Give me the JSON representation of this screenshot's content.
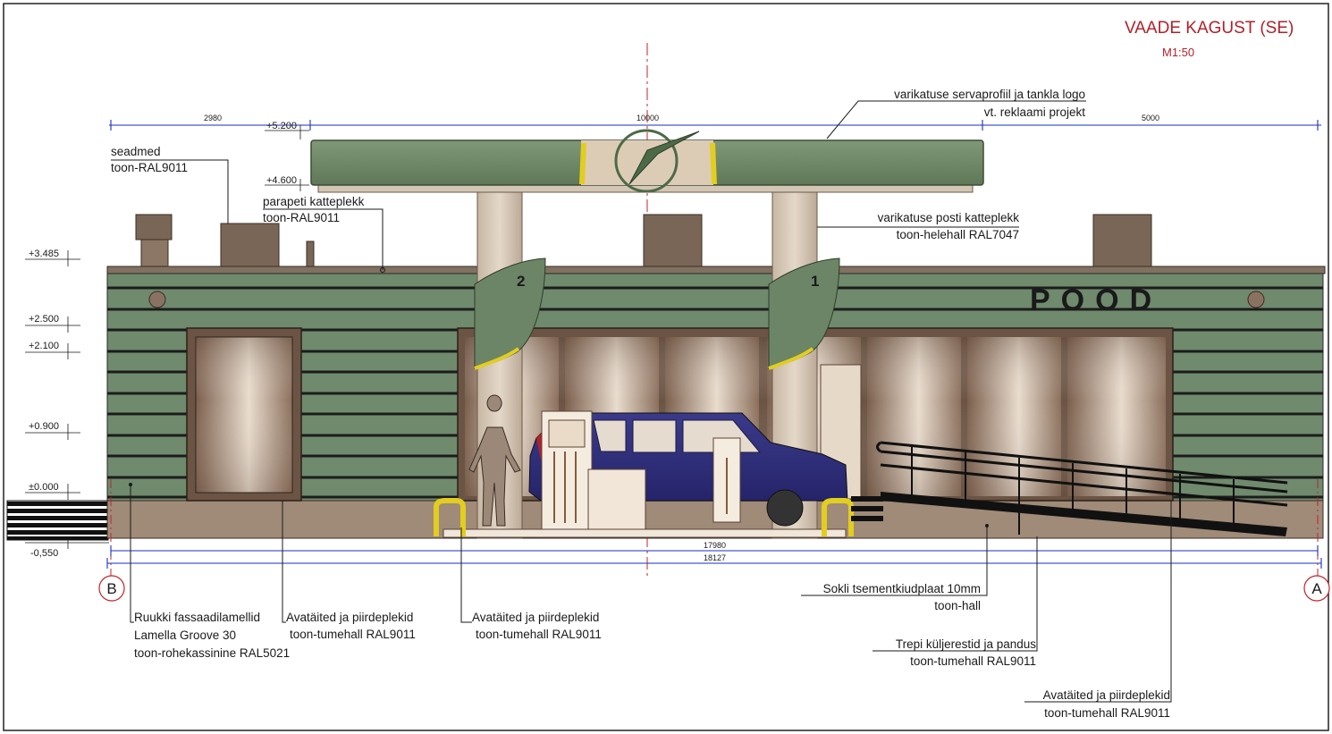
{
  "title": "VAADE KAGUST (SE)",
  "scale": "M1:50",
  "colors": {
    "facade": "#6f8a6d",
    "canopy": "#6e8766",
    "column": "#cfc1b0",
    "accent": "#e3cd1f",
    "axis": "#c0242b",
    "dimension": "#1a2ec0"
  },
  "levels": {
    "l1": "+3.485",
    "l2": "+2.500",
    "l3": "+2.100",
    "l4": "+0.900",
    "l5": "±0.000",
    "l6": "-0,550",
    "canopy_top": "+5.200",
    "canopy_bottom": "+4.600"
  },
  "dimensions": {
    "d_left": "2980",
    "d_mid": "10000",
    "d_right": "5000",
    "d_inner": "17980",
    "d_overall": "18127"
  },
  "axes": {
    "left": "B",
    "right": "A"
  },
  "sign_text": "POOD",
  "pump_numbers": {
    "left": "2",
    "right": "1"
  },
  "annotations": {
    "canopy_profile": [
      "varikatuse servaprofiil ja tankla logo",
      "vt. reklaami projekt"
    ],
    "equipment": [
      "seadmed",
      "toon-RAL9011"
    ],
    "parapet": [
      "parapeti katteplekk",
      "toon-RAL9011"
    ],
    "canopy_post": [
      "varikatuse posti katteplekk",
      "toon-helehall RAL7047"
    ],
    "facade_lamellas": [
      "Ruukki fassaadilamellid",
      "Lamella Groove 30",
      "toon-rohekassinine RAL5021"
    ],
    "guards_1": [
      "Avatäited ja piirdeplekid",
      "toon-tumehall RAL9011"
    ],
    "guards_2": [
      "Avatäited ja piirdeplekid",
      "toon-tumehall RAL9011"
    ],
    "plinth": [
      "Sokli tsementkiudplaat 10mm",
      "toon-hall"
    ],
    "stairs": [
      "Trepi küljerestid ja pandus",
      "toon-tumehall RAL9011"
    ],
    "guards_3": [
      "Avatäited ja piirdeplekid",
      "toon-tumehall RAL9011"
    ]
  }
}
